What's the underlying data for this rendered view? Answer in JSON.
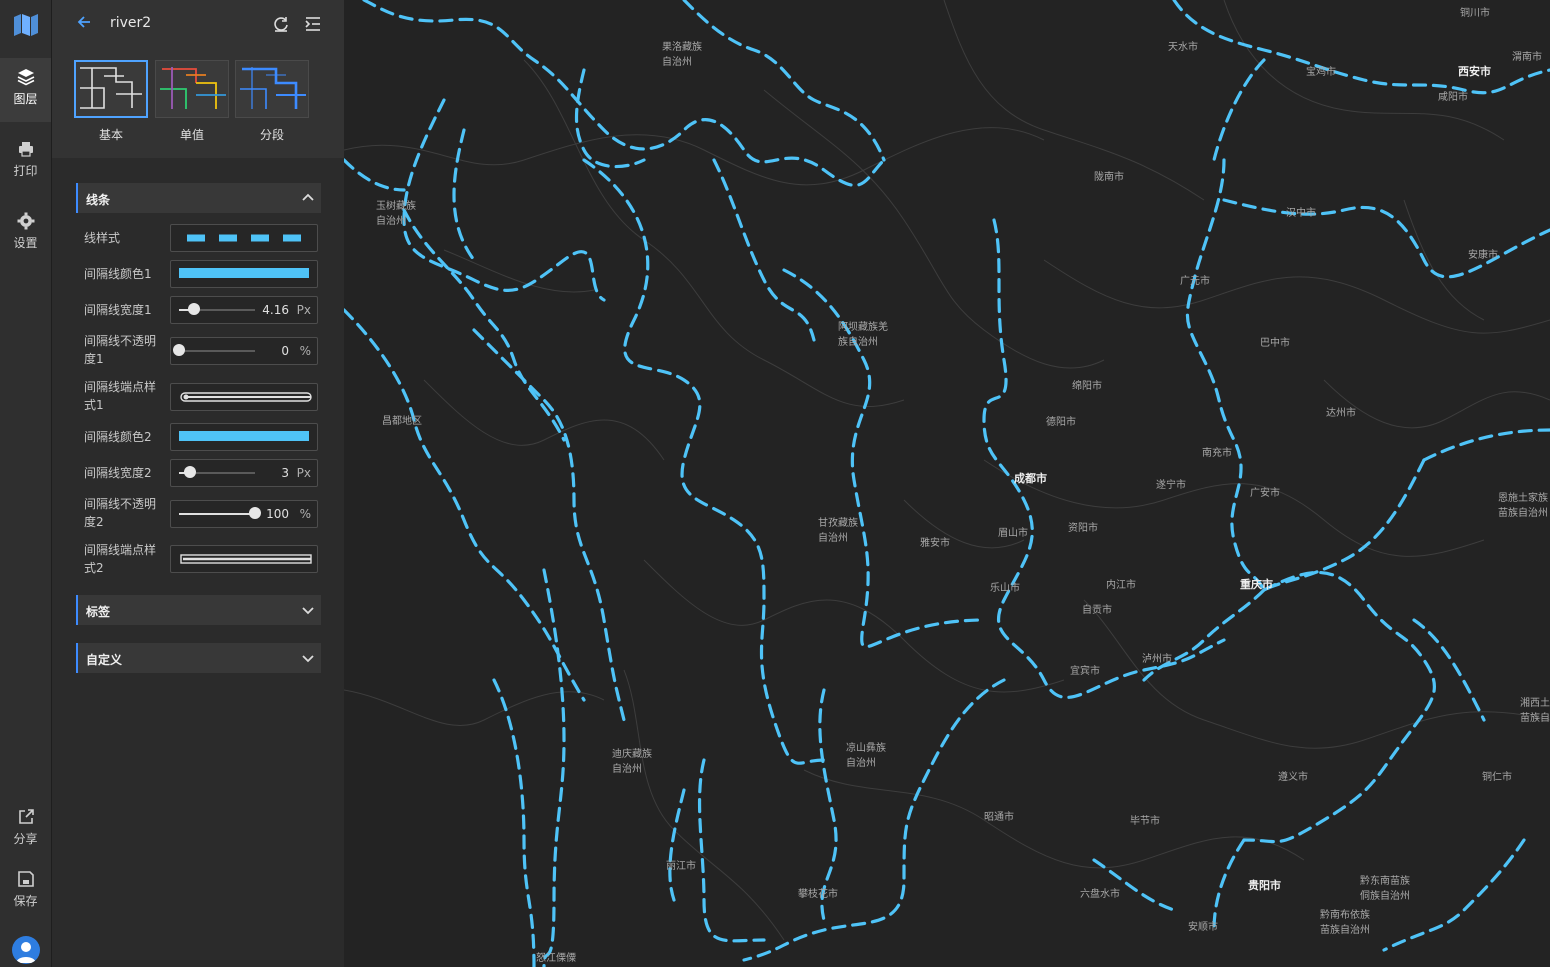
{
  "rail": {
    "items": [
      {
        "label": "图层"
      },
      {
        "label": "打印"
      },
      {
        "label": "设置"
      },
      {
        "label": "分享"
      },
      {
        "label": "保存"
      }
    ]
  },
  "panel": {
    "title": "river2",
    "styles": [
      {
        "label": "基本"
      },
      {
        "label": "单值"
      },
      {
        "label": "分段"
      }
    ],
    "sections": {
      "line": "线条",
      "label": "标签",
      "custom": "自定义"
    },
    "props": {
      "line_style": "线样式",
      "color1": "间隔线颜色1",
      "width1": "间隔线宽度1",
      "opacity1": "间隔线不透明度1",
      "cap1": "间隔线端点样式1",
      "color2": "间隔线颜色2",
      "width2": "间隔线宽度2",
      "opacity2": "间隔线不透明度2",
      "cap2": "间隔线端点样式2"
    },
    "values": {
      "width1": "4.16",
      "width1_unit": "Px",
      "width1_level": 0.2,
      "opacity1": "0",
      "opacity1_unit": "%",
      "opacity1_level": 0,
      "width2": "3",
      "width2_unit": "Px",
      "width2_level": 0.15,
      "opacity2": "100",
      "opacity2_unit": "%",
      "opacity2_level": 1
    },
    "colors": {
      "line_color": "#4fc3f7",
      "accent": "#3d8bff"
    }
  },
  "map": {
    "cities": [
      {
        "name": "果洛藏族\n自治州"
      },
      {
        "name": "天水市"
      },
      {
        "name": "宝鸡市"
      },
      {
        "name": "西安市"
      },
      {
        "name": "咸阳市"
      },
      {
        "name": "铜川市"
      },
      {
        "name": "渭南市"
      },
      {
        "name": "玉树藏族\n自治州"
      },
      {
        "name": "陇南市"
      },
      {
        "name": "汉中市"
      },
      {
        "name": "安康市"
      },
      {
        "name": "广元市"
      },
      {
        "name": "阿坝藏族羌\n族自治州"
      },
      {
        "name": "巴中市"
      },
      {
        "name": "绵阳市"
      },
      {
        "name": "德阳市"
      },
      {
        "name": "达州市"
      },
      {
        "name": "昌都地区"
      },
      {
        "name": "南充市"
      },
      {
        "name": "成都市"
      },
      {
        "name": "遂宁市"
      },
      {
        "name": "广安市"
      },
      {
        "name": "恩施土家族\n苗族自治州"
      },
      {
        "name": "甘孜藏族\n自治州"
      },
      {
        "name": "雅安市"
      },
      {
        "name": "眉山市"
      },
      {
        "name": "资阳市"
      },
      {
        "name": "乐山市"
      },
      {
        "name": "内江市"
      },
      {
        "name": "重庆市"
      },
      {
        "name": "自贡市"
      },
      {
        "name": "泸州市"
      },
      {
        "name": "宜宾市"
      },
      {
        "name": "湘西土\n苗族自"
      },
      {
        "name": "迪庆藏族\n自治州"
      },
      {
        "name": "凉山彝族\n自治州"
      },
      {
        "name": "遵义市"
      },
      {
        "name": "铜仁市"
      },
      {
        "name": "昭通市"
      },
      {
        "name": "毕节市"
      },
      {
        "name": "丽江市"
      },
      {
        "name": "攀枝花市"
      },
      {
        "name": "六盘水市"
      },
      {
        "name": "贵阳市"
      },
      {
        "name": "黔东南苗族\n侗族自治州"
      },
      {
        "name": "安顺市"
      },
      {
        "name": "黔南布依族\n苗族自治州"
      },
      {
        "name": "怒江傈僳"
      }
    ]
  }
}
